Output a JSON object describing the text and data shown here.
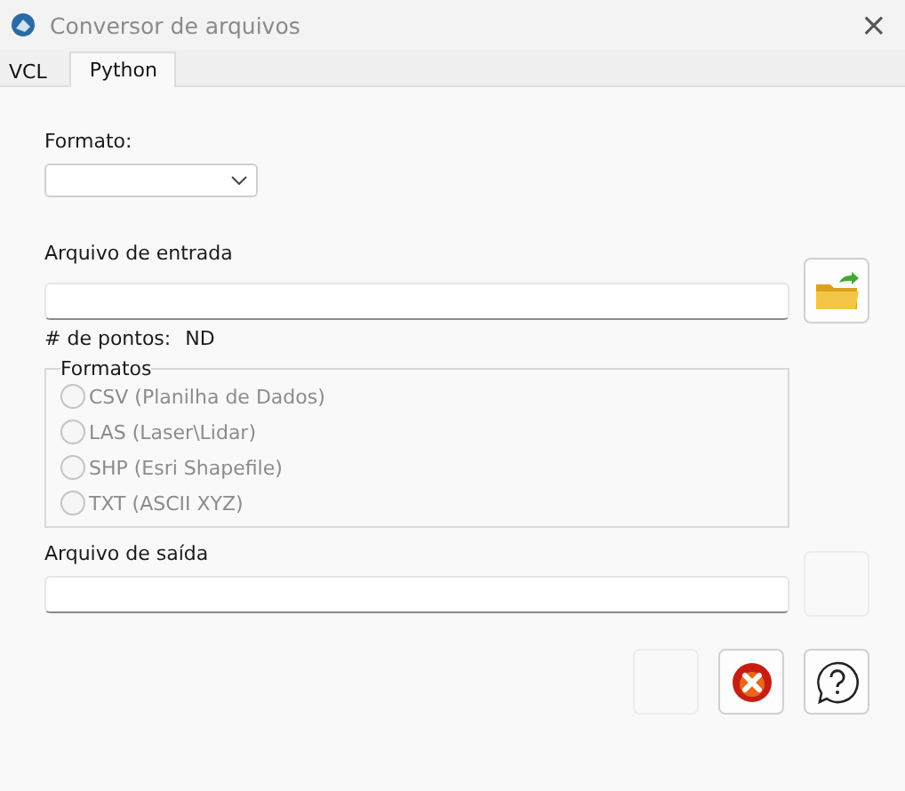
{
  "window": {
    "title": "Conversor de arquivos",
    "close": "×"
  },
  "tabs": [
    {
      "label": "VCL",
      "selected": false
    },
    {
      "label": "Python",
      "selected": true
    }
  ],
  "format_field": {
    "label": "Formato:"
  },
  "input_file": {
    "label": "Arquivo de entrada"
  },
  "points": {
    "label": "# de pontos:",
    "value": "ND"
  },
  "formats_group": {
    "title": "Formatos",
    "disabled": true,
    "options": [
      {
        "label": "CSV (Planilha de Dados)",
        "selected": false
      },
      {
        "label": "LAS (Laser\\Lidar)",
        "selected": false
      },
      {
        "label": "SHP (Esri Shapefile)",
        "selected": false
      },
      {
        "label": "TXT (ASCII XYZ)",
        "selected": false
      }
    ]
  },
  "output_file": {
    "label": "Arquivo de saída",
    "browse_disabled": true
  },
  "buttons": [
    {
      "kind": "blank",
      "disabled": true
    },
    {
      "kind": "cancel",
      "disabled": false
    },
    {
      "kind": "help",
      "disabled": false
    }
  ]
}
